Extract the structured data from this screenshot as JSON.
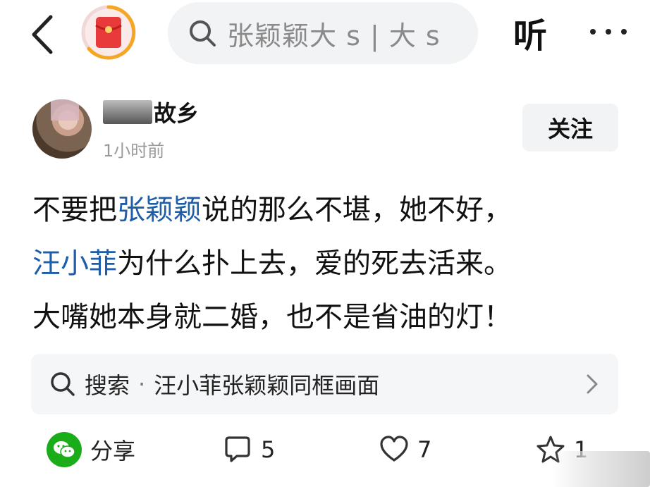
{
  "header": {
    "search_text": "张颖颖大 s | 大 s",
    "listen_label": "听"
  },
  "author": {
    "name": "故乡",
    "time": "1小时前",
    "follow_label": "关注"
  },
  "post": {
    "line1": {
      "before": "不要把",
      "topic": "张颖颖",
      "after": "说的那么不堪，她不好，"
    },
    "line2": {
      "topic": "汪小菲",
      "after": "为什么扑上去，爱的死去活来。"
    },
    "line3": "大嘴她本身就二婚，也不是省油的灯！"
  },
  "search_suggestion": {
    "label": "搜索",
    "separator": "·",
    "term": "汪小菲张颖颖同框画面"
  },
  "actions": {
    "share_label": "分享",
    "comment_count": "5",
    "like_count": "7",
    "favorite_count": "1"
  },
  "colors": {
    "topic_link": "#1e5ea8",
    "wechat_green": "#1aad19",
    "redpacket_red": "#e83a3a",
    "redpacket_ring": "#f5a623"
  }
}
